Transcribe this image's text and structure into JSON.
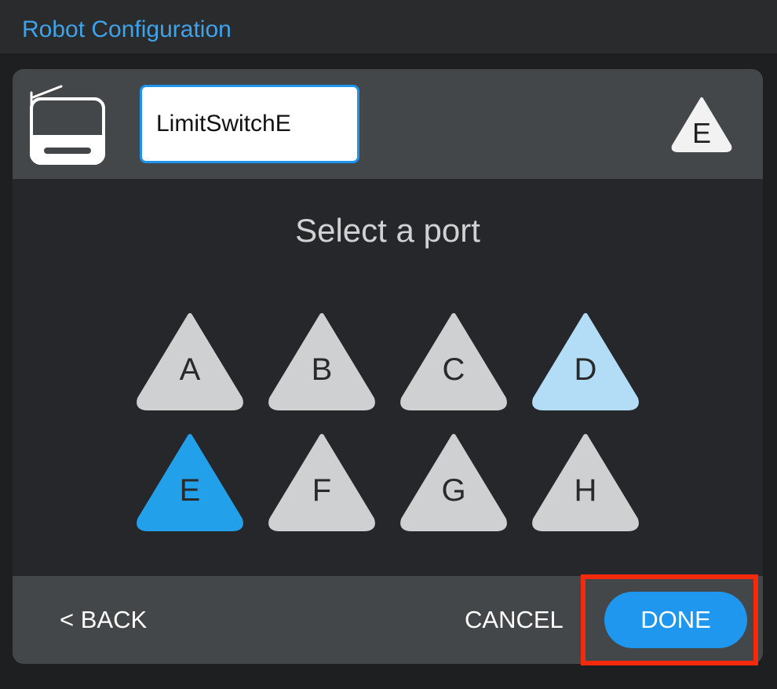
{
  "window": {
    "title": "Robot Configuration"
  },
  "device": {
    "icon": "limit-switch-device-icon",
    "name_value": "LimitSwitchE",
    "selected_port_badge": "E"
  },
  "port_selector": {
    "label": "Select a port",
    "ports": [
      {
        "label": "A",
        "state": "available"
      },
      {
        "label": "B",
        "state": "available"
      },
      {
        "label": "C",
        "state": "available"
      },
      {
        "label": "D",
        "state": "in-use"
      },
      {
        "label": "E",
        "state": "selected"
      },
      {
        "label": "F",
        "state": "available"
      },
      {
        "label": "G",
        "state": "available"
      },
      {
        "label": "H",
        "state": "available"
      }
    ]
  },
  "footer": {
    "back_label": "< BACK",
    "cancel_label": "CANCEL",
    "done_label": "DONE"
  },
  "colors": {
    "accent": "#1f97ef",
    "title": "#3fa3ea",
    "port_available": "#cfd0d1",
    "port_in_use": "#b3dcf6",
    "port_selected": "#23a0ea",
    "highlight": "#f52a0c"
  }
}
